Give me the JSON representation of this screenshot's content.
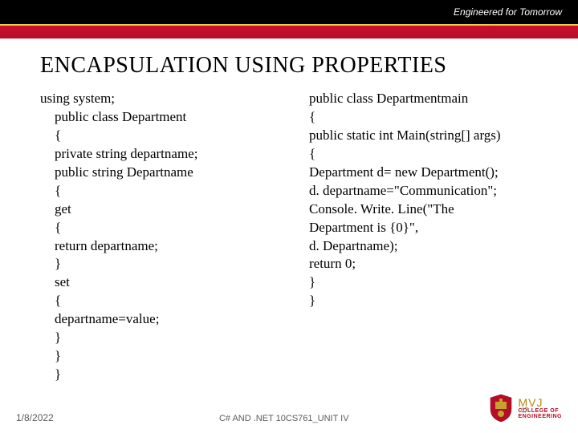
{
  "header": {
    "tagline": "Engineered for Tomorrow"
  },
  "title": "ENCAPSULATION USING PROPERTIES",
  "code": {
    "left": {
      "l0": "using system;",
      "l1": "public class Department",
      "l2": "{",
      "l3": "private string departname;",
      "l4": "public string Departname",
      "l5": "{",
      "l6": "get",
      "l7": "{",
      "l8": "return departname;",
      "l9": "}",
      "l10": "set",
      "l11": "{",
      "l12": "departname=value;",
      "l13": "}",
      "l14": "}",
      "l15": "}"
    },
    "right": {
      "r0": "public class Departmentmain",
      "r1": "{",
      "r2": "public static int Main(string[] args)",
      "r3": "{",
      "r4": "Department d= new Department();",
      "r5": "d. departname=\"Communication\";",
      "r6": "Console. Write. Line(\"The",
      "r7": "Department is {0}\",",
      "r8": "d. Departname);",
      "r9": "return 0;",
      "r10": "}",
      "r11": "}"
    }
  },
  "footer": {
    "date": "1/8/2022",
    "course": "C# AND .NET 10CS761_UNIT IV",
    "page": "47",
    "logo": {
      "main": "MVJ",
      "sub1": "COLLEGE OF",
      "sub2": "ENGINEERING"
    }
  }
}
